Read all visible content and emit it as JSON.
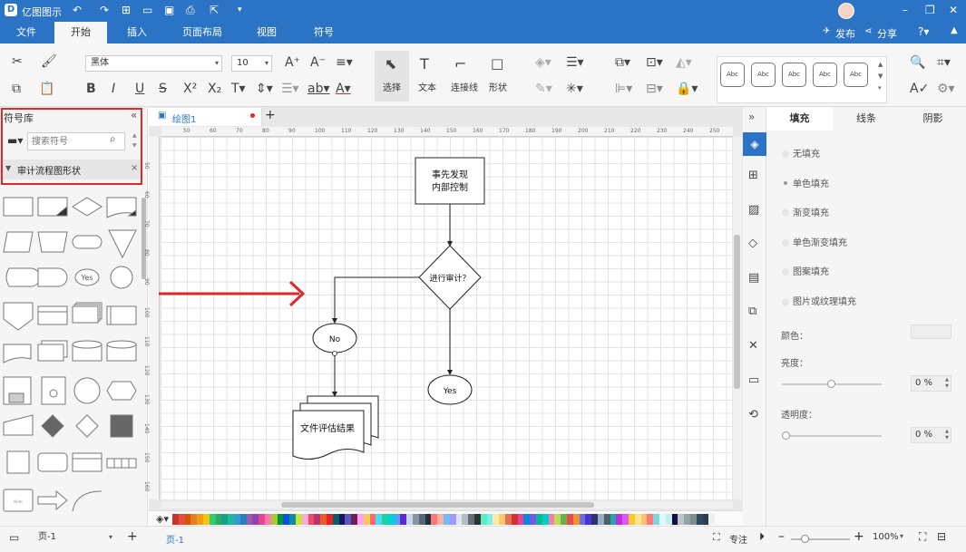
{
  "app": {
    "name": "亿图图示",
    "colors": {
      "brand": "#2b73c4",
      "accent": "#e02828",
      "fill_panel_icon": "#2b73c4"
    }
  },
  "menu": {
    "tabs": [
      "文件",
      "开始",
      "插入",
      "页面布局",
      "视图",
      "符号"
    ],
    "active": "开始",
    "publish": "发布",
    "share": "分享",
    "help_icon": "help-icon"
  },
  "ribbon": {
    "font_name": "黑体",
    "font_size": "10",
    "select_label": "选择",
    "text_label": "文本",
    "connector_label": "连接线",
    "shape_label": "形状",
    "style_presets": [
      "Abc",
      "Abc",
      "Abc",
      "Abc",
      "Abc"
    ]
  },
  "left_panel": {
    "title": "符号库",
    "search_placeholder": "搜索符号",
    "category": "审计流程图形状",
    "yes_shape_label": "Yes",
    "note_shape_label": "Note"
  },
  "document": {
    "tab_name": "绘图1"
  },
  "rulers": {
    "h": [
      "50",
      "60",
      "70",
      "80",
      "90",
      "100",
      "110",
      "120",
      "130",
      "140",
      "150",
      "160",
      "170",
      "180",
      "190",
      "200",
      "210",
      "220",
      "230",
      "240",
      "250"
    ],
    "v": [
      "50",
      "60",
      "70",
      "80",
      "90",
      "100",
      "110",
      "120",
      "130",
      "140",
      "150",
      "160"
    ]
  },
  "flowchart": {
    "start_box": "事先发现\n内部控制",
    "decision": "进行审计？",
    "no_label": "No",
    "yes_label": "Yes",
    "doc_label": "文件评估结果"
  },
  "right_panel": {
    "tabs": [
      "填充",
      "线条",
      "阴影"
    ],
    "fill_options": [
      "无填充",
      "单色填充",
      "渐变填充",
      "单色渐变填充",
      "图案填充",
      "图片或纹理填充"
    ],
    "color_label": "颜色：",
    "brightness_label": "亮度：",
    "brightness_value": "0 %",
    "transparency_label": "透明度：",
    "transparency_value": "0 %"
  },
  "status": {
    "page_select": "页-1",
    "page_tab": "页-1",
    "focus_label": "专注",
    "zoom": "100%"
  },
  "palette": [
    "#c0392b",
    "#e74c3c",
    "#d35400",
    "#e67e22",
    "#f39c12",
    "#f1c40f",
    "#2ecc71",
    "#27ae60",
    "#16a085",
    "#1abc9c",
    "#3498db",
    "#2980b9",
    "#9b59b6",
    "#8e44ad",
    "#e84393",
    "#fd79a8",
    "#a3cb38",
    "#009432",
    "#0652dd",
    "#1289a7",
    "#c4e538",
    "#fda7df",
    "#ed4c67",
    "#b53471",
    "#ee5a24",
    "#ea2027",
    "#006266",
    "#1b1464",
    "#5758bb",
    "#6f1e51",
    "#ff9ff3",
    "#feca57",
    "#ff6b6b",
    "#48dbfb",
    "#1dd1a1",
    "#00d2d3",
    "#54a0ff",
    "#5f27cd",
    "#c8d6e5",
    "#8395a7",
    "#576574",
    "#222f3e",
    "#ff7675",
    "#fab1a0",
    "#74b9ff",
    "#a29bfe",
    "#dfe6e9",
    "#b2bec3",
    "#636e72",
    "#2d3436",
    "#55efc4",
    "#81ecec",
    "#ffeaa7",
    "#fdcb6e",
    "#e17055",
    "#d63031",
    "#e84393",
    "#0984e3",
    "#6c5ce7",
    "#00b894",
    "#00cec9",
    "#fd79a8",
    "#badc58",
    "#6ab04c",
    "#eb4d4b",
    "#f0932b",
    "#686de0",
    "#4834d4",
    "#30336b",
    "#95afc0",
    "#535c68",
    "#22a6b3",
    "#be2edd",
    "#e056fd",
    "#f9ca24",
    "#f6e58d",
    "#ffbe76",
    "#ff7979",
    "#7ed6df",
    "#dff9fb",
    "#c7ecee",
    "#130f40",
    "#bdc3c7",
    "#95a5a6",
    "#7f8c8d",
    "#34495e",
    "#2c3e50",
    "#ecf0f1"
  ]
}
